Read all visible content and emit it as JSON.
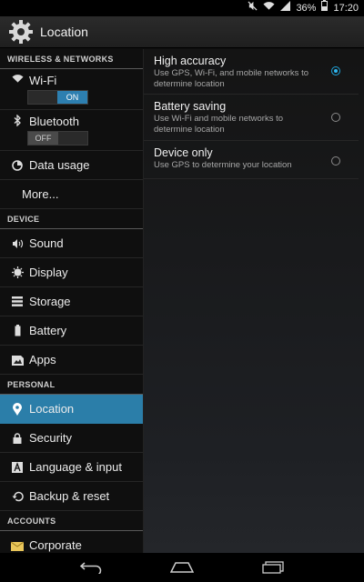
{
  "status": {
    "battery": "36%",
    "time": "17:20"
  },
  "header": {
    "title": "Location"
  },
  "sidebar": {
    "sections": [
      "WIRELESS & NETWORKS",
      "DEVICE",
      "PERSONAL",
      "ACCOUNTS"
    ],
    "wifi": {
      "label": "Wi-Fi",
      "toggle": "ON"
    },
    "bluetooth": {
      "label": "Bluetooth",
      "toggle": "OFF"
    },
    "data_usage": "Data usage",
    "more": "More...",
    "sound": "Sound",
    "display": "Display",
    "storage": "Storage",
    "battery": "Battery",
    "apps": "Apps",
    "location": "Location",
    "security": "Security",
    "language": "Language & input",
    "backup": "Backup & reset",
    "corporate": "Corporate"
  },
  "modes": [
    {
      "title": "High accuracy",
      "desc": "Use GPS, Wi-Fi, and mobile networks to determine location",
      "selected": true
    },
    {
      "title": "Battery saving",
      "desc": "Use Wi-Fi and mobile networks to determine location",
      "selected": false
    },
    {
      "title": "Device only",
      "desc": "Use GPS to determine your location",
      "selected": false
    }
  ],
  "colors": {
    "accent": "#2b7ea9",
    "radio": "#2fb7f0"
  }
}
